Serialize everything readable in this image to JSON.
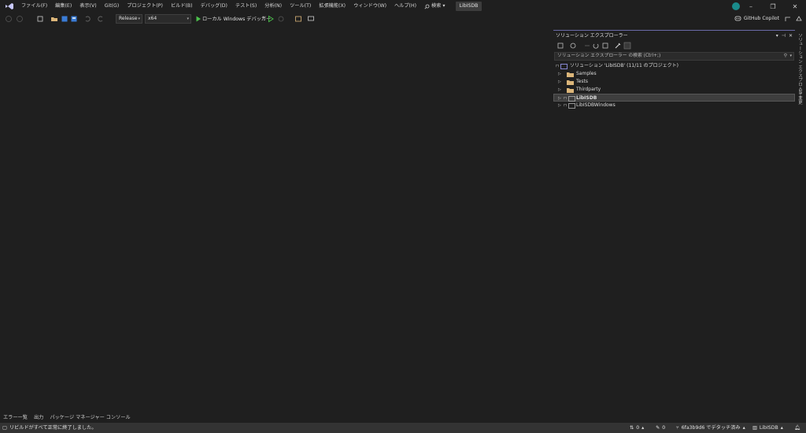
{
  "menubar": {
    "items": [
      "ファイル(F)",
      "編集(E)",
      "表示(V)",
      "Git(G)",
      "プロジェクト(P)",
      "ビルド(B)",
      "デバッグ(D)",
      "テスト(S)",
      "分析(N)",
      "ツール(T)",
      "拡張機能(X)",
      "ウィンドウ(W)",
      "ヘルプ(H)"
    ],
    "search_label": "検索",
    "solution_name": "LibISDB"
  },
  "toolbar": {
    "configuration": "Release",
    "platform": "x64",
    "run_target": "ローカル Windows デバッガー",
    "copilot_label": "GitHub Copilot"
  },
  "solution_explorer": {
    "title": "ソリューション エクスプローラー",
    "search_placeholder": "ソリューション エクスプローラー の検索 (Ctrl+;)",
    "solution_label": "ソリューション 'LibISDB' (11/11 のプロジェクト)",
    "items": [
      {
        "label": "Samples",
        "type": "folder"
      },
      {
        "label": "Tests",
        "type": "folder"
      },
      {
        "label": "Thirdparty",
        "type": "folder"
      },
      {
        "label": "LibISDB",
        "type": "project"
      },
      {
        "label": "LibISDBWindows",
        "type": "project"
      }
    ]
  },
  "side_tabs": [
    "ソリューション エクスプローラー",
    "Git 変更"
  ],
  "bottom_tabs": [
    "エラー一覧",
    "出力",
    "パッケージ マネージャー コンソール"
  ],
  "statusbar": {
    "message": "リビルドがすべて正常に終了しました。",
    "errors": "0",
    "edits": "0",
    "branch": "6fa3b9d6 でデタッチ済み",
    "repo": "LibISDB"
  },
  "colors": {
    "accent_purple": "#6a6aa6",
    "background": "#1f1f1f",
    "statusbar": "#333333",
    "folder": "#dcb67a"
  }
}
